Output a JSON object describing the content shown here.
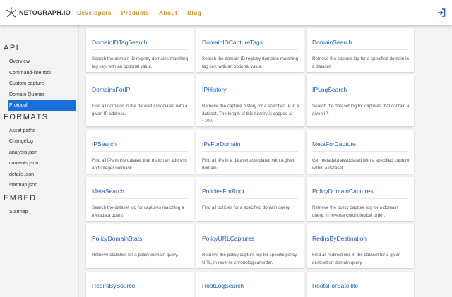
{
  "header": {
    "logo_text": "NETOGRAPH.IO",
    "nav": [
      "Developers",
      "Products",
      "About",
      "Blog"
    ],
    "accent": "#c8962e",
    "login_icon": "login-icon"
  },
  "sidebar": {
    "sections": [
      {
        "title": "API",
        "items": [
          "Overview",
          "Command-line tool",
          "Custom capture",
          "Domain Queries",
          "Protocol"
        ]
      },
      {
        "title": "FORMATS",
        "items": [
          "Asset paths",
          "Changelog",
          "analysis.json",
          "contents.json",
          "details.json",
          "starmap.json"
        ]
      },
      {
        "title": "EMBED",
        "items": [
          "Starmap"
        ]
      }
    ],
    "active_item": "Protocol",
    "active_color": "#1b6fd9"
  },
  "cards": [
    {
      "title": "DomainIDTagSearch",
      "desc": "Search the domain ID registry domains matching tag key, with an optional value."
    },
    {
      "title": "DomainIDCaptureTags",
      "desc": "Search the domain ID registry domains matching tag key, with an optional value."
    },
    {
      "title": "DomainSearch",
      "desc": "Retrieve the capture log for a specified domain in a dataset."
    },
    {
      "title": "DomainsForIP",
      "desc": "Find all domains in the dataset associated with a given IP address."
    },
    {
      "title": "IPHistory",
      "desc": "Retrieve the capture history for a specified IP in a dataset. The length of this history is capped at ~100."
    },
    {
      "title": "IPLogSearch",
      "desc": "Search the dataset log for captures that contain a given IP."
    },
    {
      "title": "IPSearch",
      "desc": "Find all IPs in the dataset that match an address and integer netmask."
    },
    {
      "title": "IPsForDomain",
      "desc": "Find all IPs in a dataset associated with a given domain."
    },
    {
      "title": "MetaForCapture",
      "desc": "Get metadata associated with a specified capture within a dataset."
    },
    {
      "title": "MetaSearch",
      "desc": "Search the dataset log for captures matching a metadata query."
    },
    {
      "title": "PoliciesForRoot",
      "desc": "Find all policies for a specified domain query."
    },
    {
      "title": "PolicyDomainCaptures",
      "desc": "Retrieve the policy capture log for a domain query, in reverse chronological order."
    },
    {
      "title": "PolicyDomainStats",
      "desc": "Retrieve statistics for a policy domain query."
    },
    {
      "title": "PolicyURLCaptures",
      "desc": "Retrieve the policy capture log for specific policy URL, in reverse chronological order."
    },
    {
      "title": "RedirsByDestination",
      "desc": "Find all redirections in the dataset for a given destination domain query."
    },
    {
      "title": "RedirsBySource",
      "desc": ""
    },
    {
      "title": "RootLogSearch",
      "desc": ""
    },
    {
      "title": "RootsForSatellite",
      "desc": ""
    }
  ]
}
